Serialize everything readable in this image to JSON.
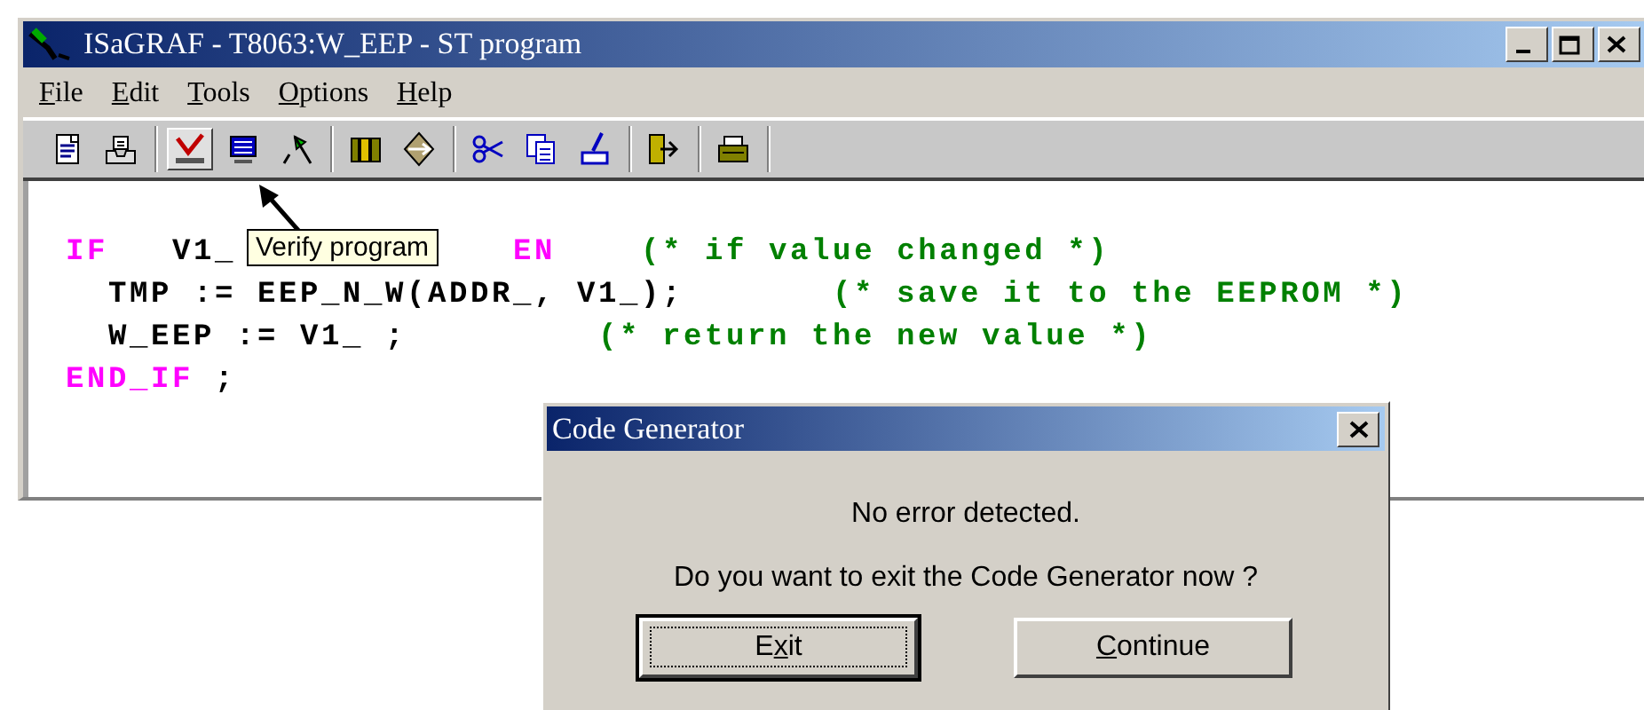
{
  "window": {
    "title": "ISaGRAF - T8063:W_EEP - ST program"
  },
  "menu": [
    {
      "key": "F",
      "rest": "ile"
    },
    {
      "key": "E",
      "rest": "dit"
    },
    {
      "key": "T",
      "rest": "ools"
    },
    {
      "key": "O",
      "rest": "ptions"
    },
    {
      "key": "H",
      "rest": "elp"
    }
  ],
  "toolbar": [
    {
      "buttons": [
        {
          "hovered": false
        },
        {
          "hovered": false
        }
      ]
    },
    {
      "buttons": [
        {
          "hovered": true
        },
        {
          "hovered": false
        },
        {
          "hovered": false
        }
      ]
    },
    {
      "buttons": [
        {
          "hovered": false
        },
        {
          "hovered": false
        }
      ]
    },
    {
      "buttons": [
        {
          "hovered": false
        },
        {
          "hovered": false
        },
        {
          "hovered": false
        }
      ]
    },
    {
      "buttons": [
        {
          "hovered": false
        }
      ]
    },
    {
      "buttons": [
        {
          "hovered": false
        }
      ]
    }
  ],
  "code_lines": [
    [
      {
        "kind": "keyword",
        "text": "IF"
      },
      {
        "kind": "code",
        "text": "V1_"
      },
      {
        "kind": "keyword",
        "text": "EN"
      },
      {
        "kind": "comment",
        "text": "(* if value changed *)"
      }
    ],
    [
      {
        "kind": "code",
        "text": "TMP := EEP_N_W(ADDR_, V1_);"
      },
      {
        "kind": "comment",
        "text": "(* save it to the EEPROM *)"
      }
    ],
    [
      {
        "kind": "code",
        "text": "W_EEP := V1_ ;"
      },
      {
        "kind": "comment",
        "text": "(* return the new value *)"
      }
    ],
    [
      {
        "kind": "keyword",
        "text": "END_IF"
      },
      {
        "kind": "code",
        "text": ";"
      }
    ]
  ],
  "tooltip": "Verify program",
  "dialog": {
    "title": "Code Generator",
    "message": "No error detected.",
    "question": "Do you want to exit the Code Generator now ?",
    "buttons": [
      {
        "lead": "E",
        "key": "x",
        "rest": "it",
        "default": true
      },
      {
        "key": "C",
        "rest": "ontinue",
        "default": false
      }
    ]
  }
}
